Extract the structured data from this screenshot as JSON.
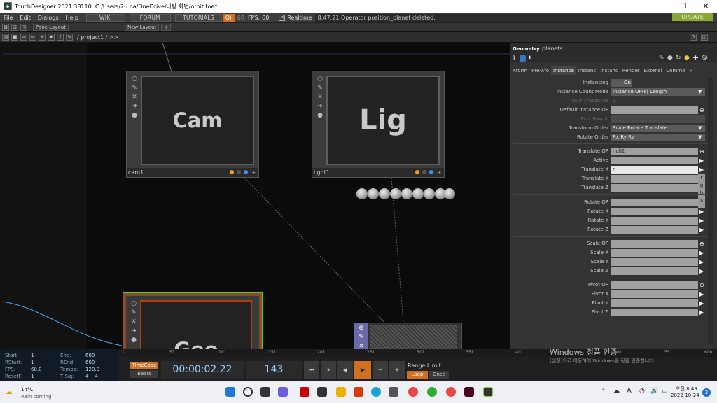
{
  "window": {
    "title": "TouchDesigner 2021.38110: C:/Users/2u.na/OneDrive/바탕 화면/orbit.toe*"
  },
  "menu": {
    "items": [
      "File",
      "Edit",
      "Dialogs",
      "Help"
    ],
    "wiki": "WIKI",
    "forum": "FORUM",
    "tutorials": "TUTORIALS",
    "oii": "OII",
    "fps_label": "FPS:",
    "fps_value": "60",
    "realtime": "Realtime",
    "status": "8:47:21 Operator position_planet deleted.",
    "update": "UPDATE",
    "sixty": "60"
  },
  "panebar": {
    "pane_layout": "Pane Layout",
    "new_layout": "New Layout",
    "plus": "+"
  },
  "path": {
    "text": "/ project1 / >>"
  },
  "nodes": {
    "cam": {
      "title": "Cam",
      "name": "cam1"
    },
    "light": {
      "title": "Lig",
      "name": "light1"
    },
    "geo": {
      "title": "Geo"
    }
  },
  "panel": {
    "type": "Geometry",
    "name": "planets",
    "tabs": [
      "Xform",
      "Pre-Xfo",
      "Instance",
      "Instanc",
      "Instanc",
      "Render",
      "Extensi",
      "Commo",
      "»"
    ],
    "params": [
      {
        "label": "Instancing",
        "value": "On"
      },
      {
        "label": "Instance Count Mode",
        "value": "Instance OP(s) Length"
      },
      {
        "label": "Num Instances",
        "value": "1"
      },
      {
        "label": "Default Instance OP",
        "value": ""
      },
      {
        "label": "First Row is",
        "value": ""
      },
      {
        "label": "Transform Order",
        "value": "Scale Rotate Translate"
      },
      {
        "label": "Rotate Order",
        "value": "Rx Ry Rz"
      },
      {
        "label": "Translate OP",
        "value": "null2"
      },
      {
        "label": "Active",
        "value": ""
      },
      {
        "label": "Translate X",
        "value": "r"
      },
      {
        "label": "Translate Y",
        "value": ""
      },
      {
        "label": "Translate Z",
        "value": ""
      },
      {
        "label": "Rotate OP",
        "value": ""
      },
      {
        "label": "Rotate X",
        "value": ""
      },
      {
        "label": "Rotate Y",
        "value": ""
      },
      {
        "label": "Rotate Z",
        "value": ""
      },
      {
        "label": "Scale OP",
        "value": ""
      },
      {
        "label": "Scale X",
        "value": ""
      },
      {
        "label": "Scale Y",
        "value": ""
      },
      {
        "label": "Scale Z",
        "value": ""
      },
      {
        "label": "Pivot OP",
        "value": ""
      },
      {
        "label": "Pivot X",
        "value": ""
      },
      {
        "label": "Pivot Y",
        "value": ""
      },
      {
        "label": "Pivot Z",
        "value": ""
      }
    ],
    "rgba": [
      "r",
      "g",
      "b",
      "a"
    ]
  },
  "timeline": {
    "start_label": "Start:",
    "start": "1",
    "rstart_label": "RStart:",
    "rstart": "1",
    "fps_label": "FPS:",
    "fps": "60.0",
    "resetf_label": "ResetF:",
    "resetf": "1",
    "end_label": "End:",
    "end": "600",
    "rend_label": "REnd:",
    "rend": "600",
    "tempo_label": "Tempo:",
    "tempo": "120.0",
    "tsig_label": "T Sig:",
    "tsig": "4    4",
    "timecode": "TimeCode",
    "beats": "Beats",
    "time": "00:00:02.22",
    "frame": "143",
    "range_limit": "Range Limit",
    "loop": "Loop",
    "once": "Once",
    "ticks": [
      "1",
      "51",
      "101",
      "151",
      "201",
      "251",
      "301",
      "351",
      "401",
      "451",
      "501",
      "551",
      "600"
    ]
  },
  "watermark": {
    "line1": "Windows 정품 인증",
    "line2": "[설정]으로 이동하여 Windows를 정품 인증합니다."
  },
  "taskbar": {
    "temp": "14°C",
    "weather": "Rain coming",
    "time": "오전 8:49",
    "date": "2022-10-24",
    "lang": "A",
    "badge": "2"
  }
}
